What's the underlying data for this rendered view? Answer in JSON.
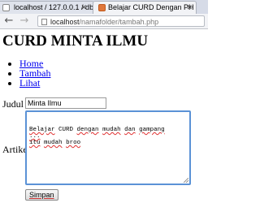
{
  "browser": {
    "tabs": [
      {
        "label": "localhost / 127.0.0.1 / db",
        "active": false
      },
      {
        "label": "Belajar CURD Dengan PH",
        "active": true
      }
    ],
    "address_host": "localhost",
    "address_path": "/namafolder/tambah.php",
    "icons": [
      "back-icon",
      "forward-icon",
      "page-icon",
      "close-icon",
      "favicon"
    ]
  },
  "page": {
    "title": "CURD MINTA ILMU",
    "menu": [
      "Home",
      "Tambah",
      "Lihat"
    ],
    "form": {
      "judul_label": "Judul",
      "judul_value": "Minta Ilmu",
      "artikel_label": "Artikel",
      "artikel_lines": [
        [
          "Belajar",
          " CURD ",
          "dengan",
          " ",
          "mudah",
          " ",
          "dan",
          " ",
          "gampang"
        ],
        [
          "..."
        ],
        [
          "itu",
          " ",
          "mudah",
          " ",
          "broo"
        ]
      ],
      "submit_label": "Simpan"
    }
  },
  "colors": {
    "link": "#0000ee",
    "focus_border": "#5b92d6",
    "spell_underline": "#e03030"
  }
}
